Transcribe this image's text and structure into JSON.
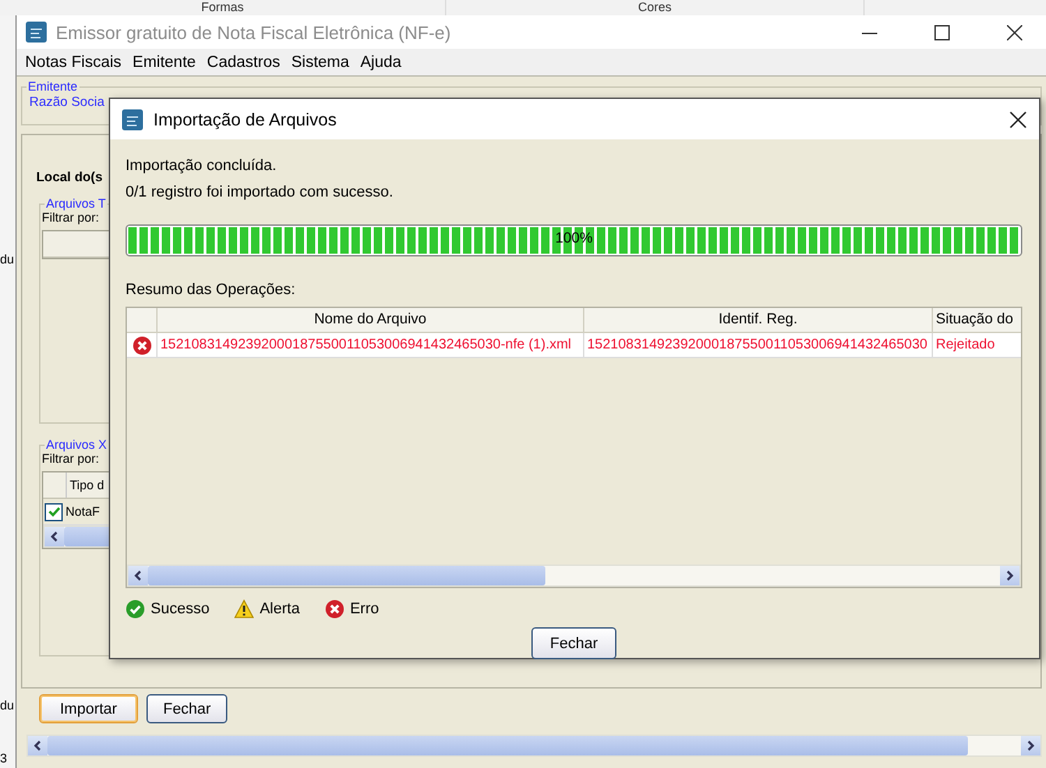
{
  "back_window": {
    "columns": [
      "Formas",
      "Cores"
    ],
    "fragments": [
      "du",
      "du",
      "3"
    ]
  },
  "window": {
    "title": "Emissor gratuito de Nota Fiscal Eletrônica (NF-e)",
    "menu": [
      "Notas Fiscais",
      "Emitente",
      "Cadastros",
      "Sistema",
      "Ajuda"
    ]
  },
  "emitente": {
    "legend": "Emitente",
    "label": "Razão Socia"
  },
  "local_heading": "Local do(s",
  "group_t": {
    "legend": "Arquivos T",
    "filter_label": "Filtrar por:"
  },
  "group_x": {
    "legend": "Arquivos X",
    "filter_label": "Filtrar por:",
    "column": "Tipo d",
    "rows": [
      {
        "label": "NotaF",
        "checked": true
      }
    ]
  },
  "buttons": [
    {
      "label": "Importar",
      "focused": true
    },
    {
      "label": "Fechar",
      "focused": false
    }
  ],
  "dialog": {
    "title": "Importação de Arquivos",
    "messages": [
      "Importação concluída.",
      "0/1 registro foi importado com sucesso."
    ],
    "progress": {
      "level": 1,
      "text": "100%"
    },
    "summary_label": "Resumo das Operações:",
    "columns": [
      "Nome do Arquivo",
      "Identif. Reg.",
      "Situação do"
    ],
    "rows": [
      {
        "kind": "error",
        "file": "15210831492392000187550011053006941432465030-nfe (1).xml",
        "id": "15210831492392000187550011053006941432465030",
        "situation": "Rejeitado"
      }
    ],
    "legend": [
      {
        "kind": "success",
        "label": "Sucesso"
      },
      {
        "kind": "warning",
        "label": "Alerta"
      },
      {
        "kind": "error",
        "label": "Erro"
      }
    ],
    "close_button": "Fechar"
  }
}
